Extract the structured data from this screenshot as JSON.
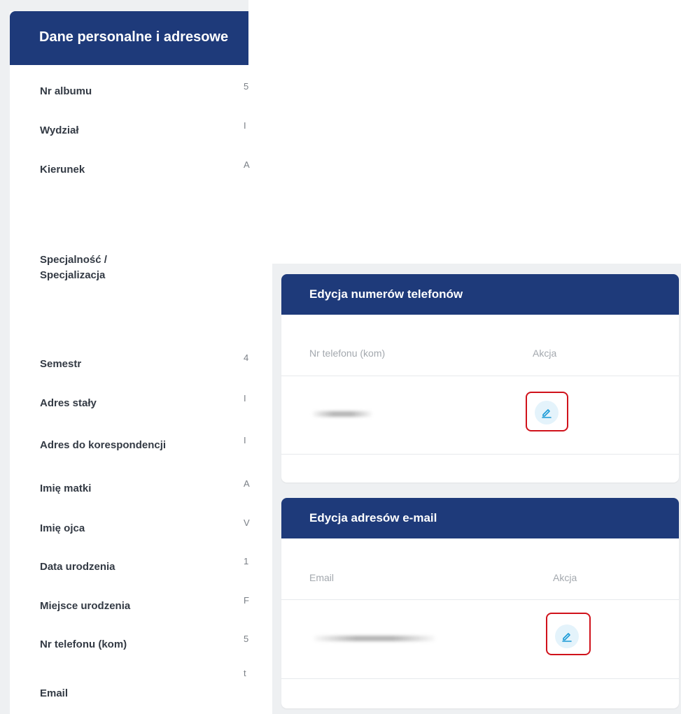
{
  "personal": {
    "title": "Dane personalne i adresowe",
    "fields": [
      {
        "label": "Nr albumu",
        "value_stub": "5"
      },
      {
        "label": "Wydział",
        "value_stub": "I"
      },
      {
        "label": "Kierunek",
        "value_stub": "A"
      },
      {
        "label": "Specjalność /",
        "value_stub": ""
      },
      {
        "label": "Specjalizacja",
        "value_stub": ""
      },
      {
        "label": "Semestr",
        "value_stub": "4"
      },
      {
        "label": "Adres stały",
        "value_stub": "I"
      },
      {
        "label": "Adres do korespondencji",
        "value_stub": "I"
      },
      {
        "label": "Imię matki",
        "value_stub": "A"
      },
      {
        "label": "Imię ojca",
        "value_stub": "V"
      },
      {
        "label": "Data urodzenia",
        "value_stub": "1"
      },
      {
        "label": "Miejsce urodzenia",
        "value_stub": "F"
      },
      {
        "label": "Nr telefonu (kom)",
        "value_stub": "5"
      },
      {
        "label": "Email",
        "value_stub": "t"
      }
    ]
  },
  "phones": {
    "title": "Edycja numerów telefonów",
    "col_value": "Nr telefonu (kom)",
    "col_action": "Akcja",
    "edit_icon": "pencil-icon"
  },
  "emails": {
    "title": "Edycja adresów e-mail",
    "col_value": "Email",
    "col_action": "Akcja",
    "edit_icon": "pencil-icon"
  },
  "colors": {
    "header": "#1e3a7a",
    "highlight": "#d0121b",
    "edit_button_bg": "#e4f3fb",
    "edit_icon": "#1a9ad6"
  }
}
